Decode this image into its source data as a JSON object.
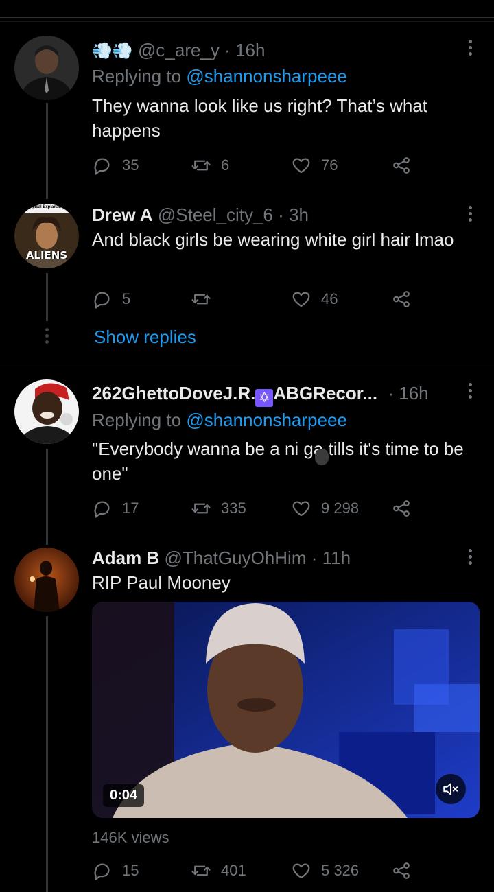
{
  "colors": {
    "background": "#000000",
    "text": "#e7e9ea",
    "secondary": "#71767b",
    "accent": "#1d9bf0",
    "divider": "#2f3336"
  },
  "tweets": [
    {
      "name_prefix": "",
      "name_emoji": "💨💨",
      "handle": "@c_are_y",
      "time": "· 16h",
      "reply_label": "Replying to",
      "reply_handle": "@shannonsharpeee",
      "text": "They wanna look like us right? That’s what happens",
      "stats": {
        "replies": "35",
        "retweets": "6",
        "likes": "76"
      }
    },
    {
      "name": "Drew A",
      "handle": "@Steel_city_6",
      "time": "· 3h",
      "text": "And black girls be wearing white girl hair lmao",
      "avatar_label": "ALIENS",
      "avatar_top_label": "Logical Explanation",
      "stats": {
        "replies": "5",
        "retweets": "",
        "likes": "46"
      },
      "show_replies": "Show replies"
    },
    {
      "name_part1": "262GhettoDoveJ.R.",
      "name_part2": "ABGRecor...",
      "time": "· 16h",
      "reply_label": "Replying to",
      "reply_handle": "@shannonsharpeee",
      "text": "\"Everybody wanna be a ni  ga tills it's time to be one\"",
      "stats": {
        "replies": "17",
        "retweets": "335",
        "likes": "9 298"
      }
    },
    {
      "name": "Adam B",
      "handle": "@ThatGuyOhHim",
      "time": "· 11h",
      "text": "RIP Paul Mooney",
      "video_duration": "0:04",
      "views": "146K views",
      "stats": {
        "replies": "15",
        "retweets": "401",
        "likes": "5 326"
      }
    }
  ]
}
